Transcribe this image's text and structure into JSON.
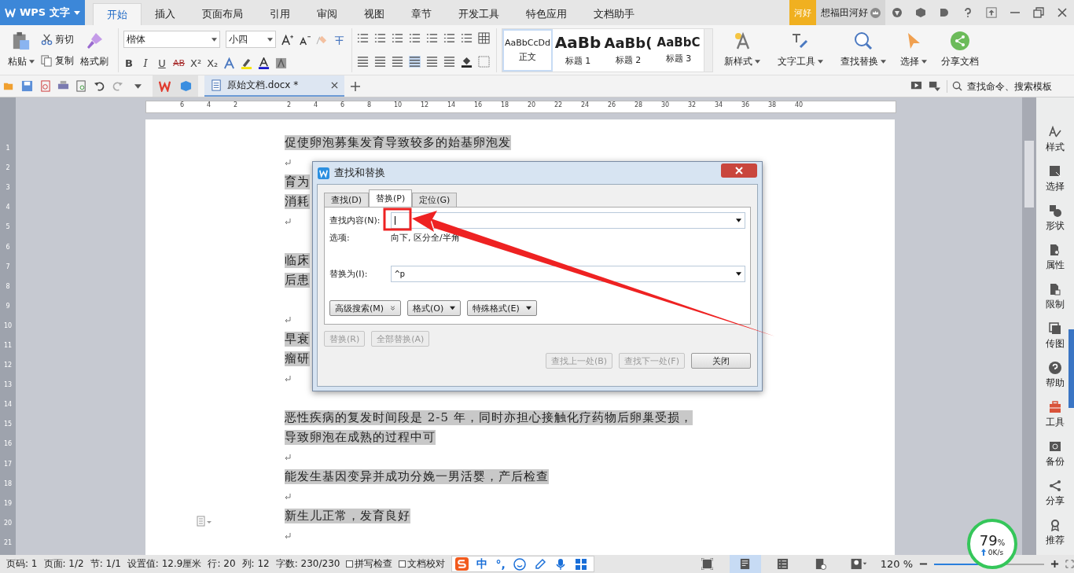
{
  "app_menu": {
    "label": "WPS 文字"
  },
  "menu_tabs": [
    {
      "label": "开始",
      "selected": true
    },
    {
      "label": "插入",
      "selected": false
    },
    {
      "label": "页面布局",
      "selected": false
    },
    {
      "label": "引用",
      "selected": false
    },
    {
      "label": "审阅",
      "selected": false
    },
    {
      "label": "视图",
      "selected": false
    },
    {
      "label": "章节",
      "selected": false
    },
    {
      "label": "开发工具",
      "selected": false
    },
    {
      "label": "特色应用",
      "selected": false
    },
    {
      "label": "文档助手",
      "selected": false
    }
  ],
  "user": {
    "badge": "河好",
    "name": "想福田河好"
  },
  "ribbon": {
    "paste": "粘贴",
    "cut": "剪切",
    "copy": "复制",
    "format_painter": "格式刷",
    "font_family": "楷体",
    "font_size": "小四",
    "format_marks": [
      "B",
      "I",
      "U",
      "AB",
      "X²",
      "X₂"
    ],
    "styles": [
      {
        "preview": "AaBbCcDd",
        "label": "正文",
        "selected": true
      },
      {
        "preview": "AaBb",
        "label": "标题 1",
        "selected": false
      },
      {
        "preview": "AaBb(",
        "label": "标题 2",
        "selected": false
      },
      {
        "preview": "AaBbC",
        "label": "标题 3",
        "selected": false
      }
    ],
    "new_style": "新样式",
    "text_tools": "文字工具",
    "find_replace": "查找替换",
    "select": "选择",
    "share": "分享文档"
  },
  "document_tab": {
    "title": "原始文档.docx *"
  },
  "command_search": {
    "placeholder": "查找命令、搜索模板"
  },
  "ruler": {
    "left_numbers": [
      "6",
      "4",
      "2"
    ],
    "right_numbers": [
      "2",
      "4",
      "6",
      "8",
      "10",
      "12",
      "14",
      "16",
      "18",
      "20",
      "22",
      "24",
      "26",
      "28",
      "30",
      "32",
      "34",
      "36",
      "38",
      "40"
    ],
    "vertical_numbers": [
      "1",
      "2",
      "3",
      "4",
      "5",
      "6",
      "7",
      "8",
      "9",
      "10",
      "11",
      "12",
      "13",
      "14",
      "15",
      "16",
      "17",
      "18",
      "19",
      "20",
      "21"
    ]
  },
  "document": {
    "lines": [
      {
        "kind": "text",
        "text": "促使卵泡募集发育导致较多的始基卵泡发"
      },
      {
        "kind": "return"
      },
      {
        "kind": "text",
        "text": "育为"
      },
      {
        "kind": "text",
        "text": "消耗"
      },
      {
        "kind": "return"
      },
      {
        "kind": "blank"
      },
      {
        "kind": "text",
        "text": "临床"
      },
      {
        "kind": "text",
        "text": "后患"
      },
      {
        "kind": "blank"
      },
      {
        "kind": "return"
      },
      {
        "kind": "text",
        "text": "早衰"
      },
      {
        "kind": "text",
        "text": "瘤研"
      },
      {
        "kind": "return"
      },
      {
        "kind": "blank"
      },
      {
        "kind": "text",
        "text": "恶性疾病的复发时间段是 2-5 年，同时亦担心接触化疗药物后卵巢受损，"
      },
      {
        "kind": "text",
        "text": "导致卵泡在成熟的过程中可"
      },
      {
        "kind": "return"
      },
      {
        "kind": "text",
        "text": "能发生基因变异并成功分娩一男活婴，产后检查"
      },
      {
        "kind": "return"
      },
      {
        "kind": "text",
        "text": "新生儿正常，发育良好"
      },
      {
        "kind": "return"
      }
    ]
  },
  "dialog": {
    "title": "查找和替换",
    "tabs": [
      {
        "label": "查找(D)",
        "selected": false
      },
      {
        "label": "替换(P)",
        "selected": true
      },
      {
        "label": "定位(G)",
        "selected": false
      }
    ],
    "find_label": "查找内容(N):",
    "options_label": "选项:",
    "options_value": "向下, 区分全/半角",
    "replace_label": "替换为(I):",
    "replace_value": "^p",
    "option_buttons": [
      {
        "label": "高级搜索(M)",
        "kind": "double"
      },
      {
        "label": "格式(O)",
        "kind": "caret"
      },
      {
        "label": "特殊格式(E)",
        "kind": "caret"
      }
    ],
    "replace_buttons": [
      {
        "label": "替换(R)",
        "disabled": true
      },
      {
        "label": "全部替换(A)",
        "disabled": true
      }
    ],
    "nav_buttons": [
      {
        "label": "查找上一处(B)",
        "disabled": true
      },
      {
        "label": "查找下一处(F)",
        "disabled": true
      },
      {
        "label": "关闭",
        "disabled": false
      }
    ]
  },
  "sidebar": {
    "items": [
      {
        "kind": "style",
        "label": "样式"
      },
      {
        "kind": "select",
        "label": "选择"
      },
      {
        "kind": "shape",
        "label": "形状"
      },
      {
        "kind": "property",
        "label": "属性"
      },
      {
        "kind": "restrict",
        "label": "限制"
      },
      {
        "kind": "image",
        "label": "传图"
      },
      {
        "kind": "help",
        "label": "帮助"
      },
      {
        "kind": "tools",
        "label": "工具"
      },
      {
        "kind": "backup",
        "label": "备份"
      },
      {
        "kind": "share",
        "label": "分享"
      },
      {
        "kind": "recommend",
        "label": "推荐"
      }
    ]
  },
  "status_bar": {
    "items": [
      "页码: 1",
      "页面: 1/2",
      "节: 1/1",
      "设置值: 12.9厘米",
      "行: 20",
      "列: 12",
      "字数: 230/230"
    ],
    "checks": [
      {
        "label": "拼写检查",
        "checked": false
      },
      {
        "label": "文档校对",
        "checked": false
      }
    ],
    "ime": {
      "lang": "中",
      "punct": "°,"
    },
    "view_modes": [
      {
        "kind": "fullscreen",
        "selected": false
      },
      {
        "kind": "page",
        "selected": true
      },
      {
        "kind": "outline",
        "selected": false
      },
      {
        "kind": "web",
        "selected": false
      },
      {
        "kind": "protect",
        "selected": false
      }
    ],
    "zoom_label": "120 %",
    "zoom": {
      "level": 0.5
    }
  },
  "network_widget": {
    "percent": "79",
    "unit": "%",
    "speed": "0K/s"
  }
}
